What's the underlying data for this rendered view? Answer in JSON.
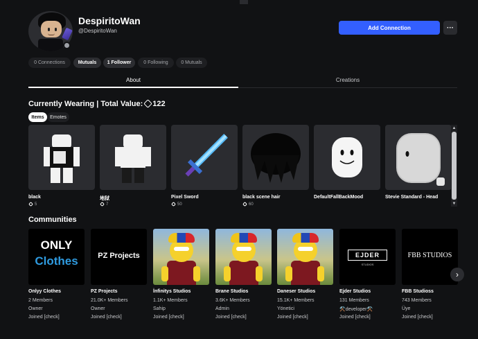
{
  "profile": {
    "display_name": "DespiritoWan",
    "username": "@DespiritoWan",
    "add_connection_label": "Add Connection",
    "more_label": "···"
  },
  "stats": [
    {
      "label": "0 Connections",
      "active": false
    },
    {
      "label": "Mutuals",
      "active": true
    },
    {
      "label": "1 Follower",
      "active": true
    },
    {
      "label": "0 Following",
      "active": false
    },
    {
      "label": "0 Mutuals",
      "active": false
    }
  ],
  "tabs": {
    "about": "About",
    "creations": "Creations"
  },
  "wearing": {
    "title": "Currently Wearing | Total Value:",
    "total_value": "122",
    "segment_items": "Items",
    "segment_emotes": "Emotes",
    "items": [
      {
        "name": "black",
        "meta": "5"
      },
      {
        "name": "地狱",
        "meta": "7"
      },
      {
        "name": "Pixel Sword",
        "meta": "50"
      },
      {
        "name": "black scene hair",
        "meta": "60"
      },
      {
        "name": "DefaultFallBackMood",
        "meta": ""
      },
      {
        "name": "Stevie Standard - Head",
        "meta": ""
      }
    ]
  },
  "communities": {
    "title": "Communities",
    "items": [
      {
        "name": "Onlyy Clothes",
        "members": "2 Members",
        "role": "Owner",
        "joined": "Joined [check]",
        "logo_line1": "ONLY",
        "logo_line2": "Clothes"
      },
      {
        "name": "PZ Projects",
        "members": "21.0K+ Members",
        "role": "Owner",
        "joined": "Joined [check]",
        "logo_line1": "PZ Projects",
        "logo_line2": ""
      },
      {
        "name": "İnfinitys Studios",
        "members": "1.1K+ Members",
        "role": "Sahip",
        "joined": "Joined [check]",
        "logo_line1": "",
        "logo_line2": ""
      },
      {
        "name": "Brane Studios",
        "members": "3.6K+ Members",
        "role": "Admin",
        "joined": "Joined [check]",
        "logo_line1": "",
        "logo_line2": ""
      },
      {
        "name": "Daneser Studios",
        "members": "15.1K+ Members",
        "role": "Yönetici",
        "joined": "Joined [check]",
        "logo_line1": "",
        "logo_line2": ""
      },
      {
        "name": "Ejder Studios",
        "members": "131 Members",
        "role": "⚒️developer⚒️",
        "joined": "Joined [check]",
        "logo_line1": "EJDER",
        "logo_line2": "STUDIOS"
      },
      {
        "name": "FBB Studioss",
        "members": "743 Members",
        "role": "Üye",
        "joined": "Joined [check]",
        "logo_line1": "FBB STUDIOS",
        "logo_line2": ""
      }
    ]
  },
  "colors": {
    "accent": "#335fff",
    "background": "#111214",
    "card": "#2b2c30"
  }
}
